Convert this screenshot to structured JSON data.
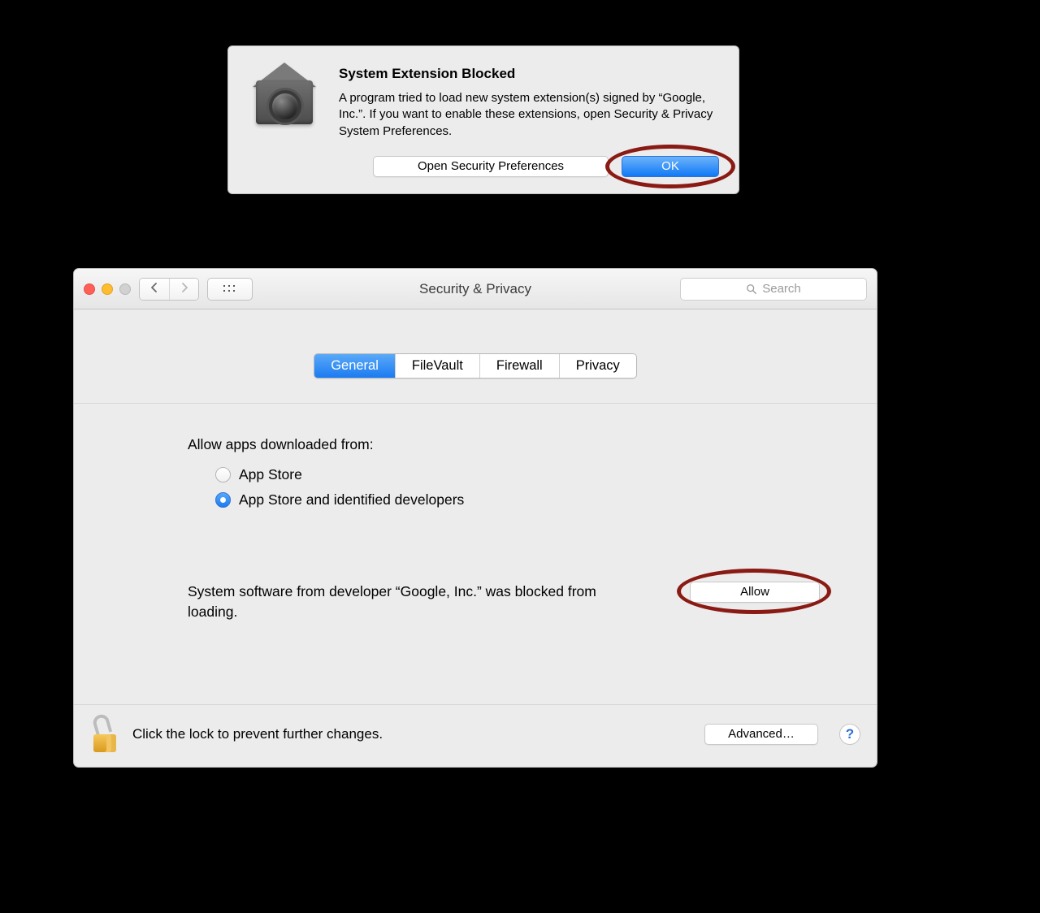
{
  "alert": {
    "title": "System Extension Blocked",
    "message": "A program tried to load new system extension(s) signed by “Google, Inc.”.  If you want to enable these extensions, open Security & Privacy System Preferences.",
    "open_button": "Open Security Preferences",
    "ok_button": "OK"
  },
  "window": {
    "title": "Security & Privacy",
    "search_placeholder": "Search",
    "tabs": [
      "General",
      "FileVault",
      "Firewall",
      "Privacy"
    ],
    "active_tab_index": 0,
    "allow_apps_label": "Allow apps downloaded from:",
    "radio_options": {
      "app_store": "App Store",
      "app_store_and_dev": "App Store and identified developers"
    },
    "selected_radio": "app_store_and_dev",
    "blocked_message": "System software from developer “Google, Inc.” was blocked from loading.",
    "allow_button": "Allow",
    "lock_hint": "Click the lock to prevent further changes.",
    "advanced_button": "Advanced…",
    "help_label": "?"
  }
}
